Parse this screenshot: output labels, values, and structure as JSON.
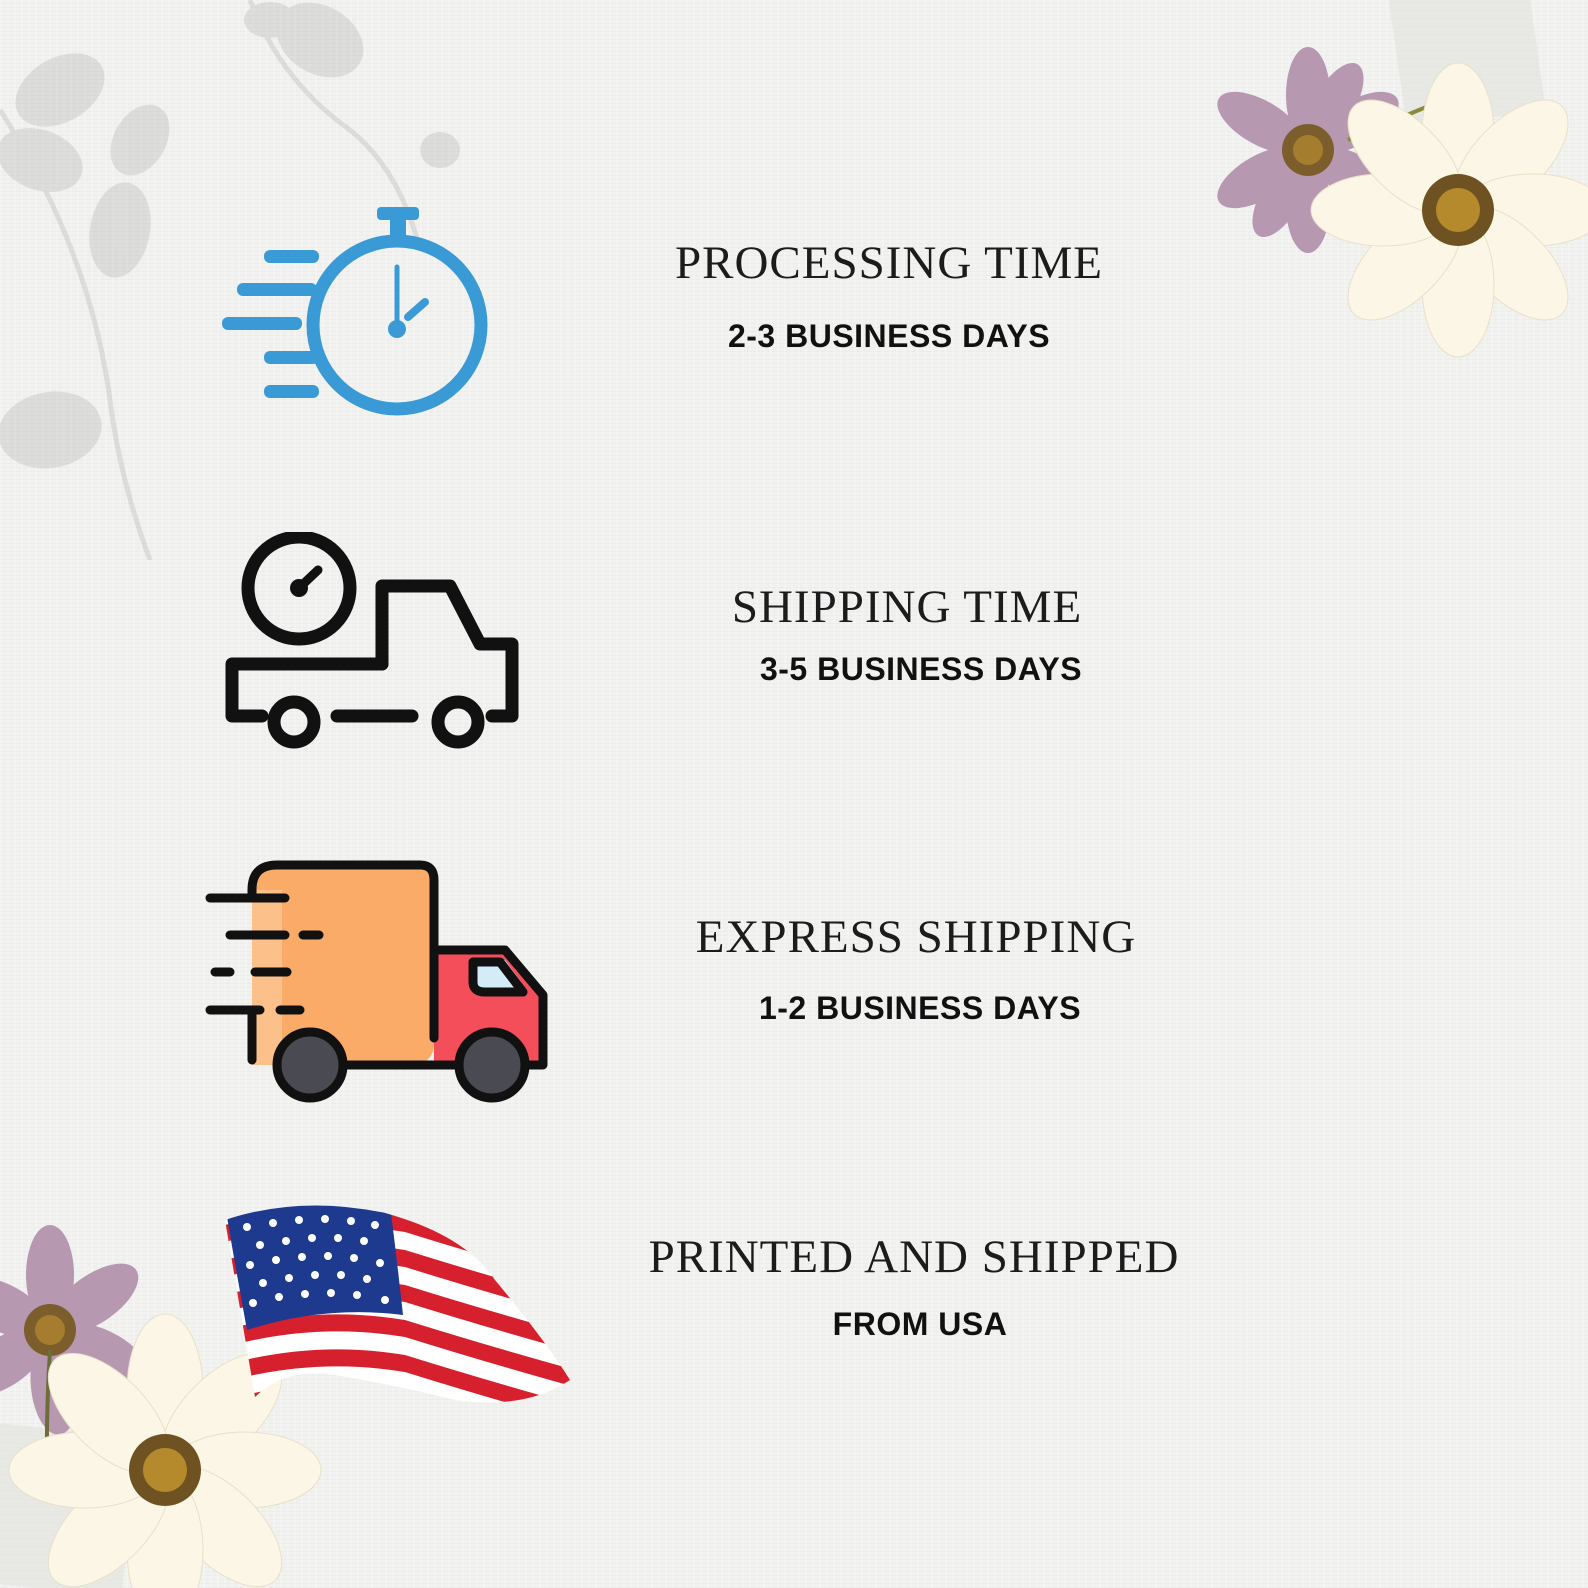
{
  "rows": [
    {
      "title": "PROCESSING TIME",
      "subtitle": "2-3 BUSINESS DAYS",
      "icon": "stopwatch-icon"
    },
    {
      "title": "SHIPPING TIME",
      "subtitle": "3-5 BUSINESS DAYS",
      "icon": "delivery-truck-outline-icon"
    },
    {
      "title": "EXPRESS SHIPPING",
      "subtitle": "1-2 BUSINESS DAYS",
      "icon": "fast-delivery-truck-icon"
    },
    {
      "title": "PRINTED AND SHIPPED",
      "subtitle": "FROM USA",
      "icon": "usa-flag-icon"
    }
  ],
  "colors": {
    "background": "#f1f1ef",
    "stopwatch_blue": "#3a9ad6",
    "truck_orange": "#f9ab67",
    "truck_red": "#f44e5a",
    "text": "#1c1c1c"
  }
}
